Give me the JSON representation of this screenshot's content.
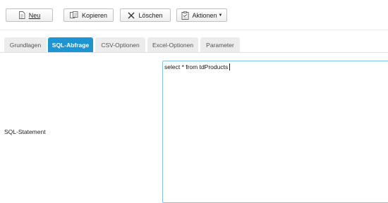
{
  "toolbar": {
    "neu_label": "Neu",
    "kopieren_label": "Kopieren",
    "loeschen_label": "Löschen",
    "aktionen_label": "Aktionen",
    "icons": {
      "neu": "document-icon",
      "kopieren": "copy-icon",
      "loeschen": "close-icon",
      "aktionen": "clipboard-icon"
    }
  },
  "tabs": [
    {
      "label": "Grundlagen",
      "active": false
    },
    {
      "label": "SQL-Abfrage",
      "active": true
    },
    {
      "label": "CSV-Optionen",
      "active": false
    },
    {
      "label": "Excel-Optionen",
      "active": false
    },
    {
      "label": "Parameter",
      "active": false
    }
  ],
  "form": {
    "sql_label": "SQL-Statement",
    "sql_value": "select * from tdProducts"
  },
  "colors": {
    "accent": "#1e95d3",
    "input_focus_border": "#7fc4ee"
  }
}
